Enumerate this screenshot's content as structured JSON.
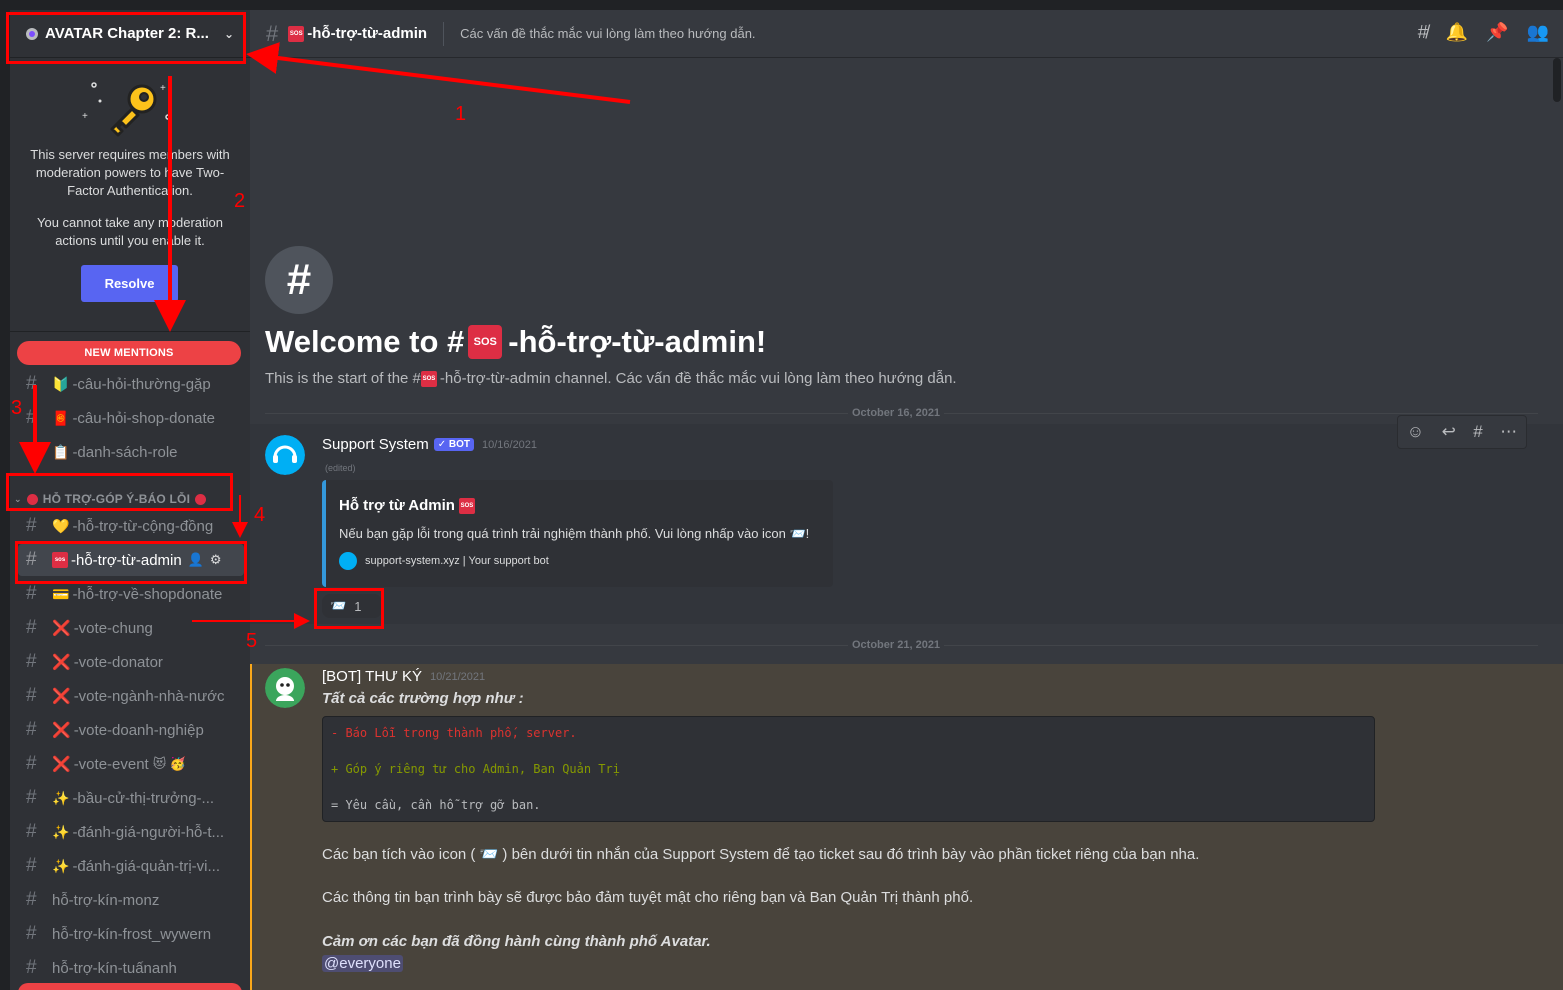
{
  "server": {
    "name": "AVATAR Chapter 2: R..."
  },
  "tfa": {
    "text1": "This server requires members with moderation powers to have Two-Factor Authentication.",
    "text2": "You cannot take any moderation actions until you enable it.",
    "resolve_label": "Resolve"
  },
  "new_mentions_label": "NEW MENTIONS",
  "channels_top": [
    {
      "label": "-câu-hỏi-thường-gặp",
      "emoji": "🔰"
    },
    {
      "label": "-câu-hỏi-shop-donate",
      "emoji": "🧧"
    },
    {
      "label": "-danh-sách-role",
      "emoji": "📋"
    }
  ],
  "category": {
    "label": "HỖ TRỢ-GÓP Ý-BÁO LỖI"
  },
  "channels": [
    {
      "label": "-hỗ-trợ-từ-cộng-đồng",
      "emoji": "💛"
    },
    {
      "label": "-hỗ-trợ-từ-admin",
      "emoji": "sos"
    },
    {
      "label": "-hỗ-trợ-về-shopdonate",
      "emoji": "💳"
    },
    {
      "label": "-vote-chung",
      "emoji": "❌"
    },
    {
      "label": "-vote-donator",
      "emoji": "❌"
    },
    {
      "label": "-vote-ngành-nhà-nước",
      "emoji": "❌"
    },
    {
      "label": "-vote-doanh-nghiệp",
      "emoji": "❌"
    },
    {
      "label": "-vote-event",
      "emoji": "❌",
      "suffix": "😻 🥳"
    },
    {
      "label": "-bầu-cử-thị-trưởng-...",
      "emoji": "✨"
    },
    {
      "label": "-đánh-giá-người-hỗ-t...",
      "emoji": "✨"
    },
    {
      "label": "-đánh-giá-quản-trị-vi...",
      "emoji": "✨"
    },
    {
      "label": "hỗ-trợ-kín-monz",
      "emoji": ""
    },
    {
      "label": "hỗ-trợ-kín-frost_wywern",
      "emoji": ""
    },
    {
      "label": "hỗ-trợ-kín-tuấnanh",
      "emoji": ""
    }
  ],
  "header": {
    "channel_name": "-hỗ-trợ-từ-admin",
    "topic": "Các vấn đề thắc mắc vui lòng làm theo hướng dẫn.",
    "icons": [
      "threads-icon",
      "bell-icon",
      "pin-icon",
      "members-icon"
    ]
  },
  "welcome": {
    "title_prefix": "Welcome to #",
    "title_suffix": "-hỗ-trợ-từ-admin!",
    "sub_prefix": "This is the start of the #",
    "sub_suffix": "-hỗ-trợ-từ-admin channel. Các vấn đề thắc mắc vui lòng làm theo hướng dẫn."
  },
  "dates": [
    "October 16, 2021",
    "October 21, 2021"
  ],
  "message1": {
    "author": "Support System",
    "bot_label": "✓ BOT",
    "timestamp": "10/16/2021",
    "edited": "(edited)",
    "embed_title": "Hỗ trợ từ Admin",
    "embed_desc": "Nếu bạn gặp lỗi trong quá trình trải nghiệm thành phố. Vui lòng nhấp vào icon 📨!",
    "embed_footer": "support-system.xyz | Your support bot",
    "reaction_emoji": "📨",
    "reaction_count": "1"
  },
  "message2": {
    "author": "[BOT] THƯ KÝ",
    "timestamp": "10/21/2021",
    "intro": "Tất cả các trường hợp như :",
    "code": [
      "- Báo Lỗi trong thành phố, server.",
      "+ Góp ý riêng tư cho Admin, Ban Quản Trị",
      "= Yêu cầu, cần hỗ trợ gỡ ban."
    ],
    "line1": "Các bạn tích vào icon ( 📨 ) bên dưới tin nhắn của Support System để tạo ticket sau đó trình bày vào phần ticket riêng của bạn nha.",
    "line2": "Các thông tin bạn trình bày sẽ được bảo đảm tuyệt mật cho riêng bạn và Ban Quản Trị thành phố.",
    "line3": "Cảm ơn các bạn đã đồng hành cùng thành phố Avatar.",
    "mention": "@everyone"
  },
  "annotations": [
    "1",
    "2",
    "3",
    "4",
    "5"
  ],
  "colors": {
    "blurple": "#5865f2",
    "danger": "#ed4245",
    "annotation": "#ff0000",
    "mention_bar": "#faa81a"
  }
}
